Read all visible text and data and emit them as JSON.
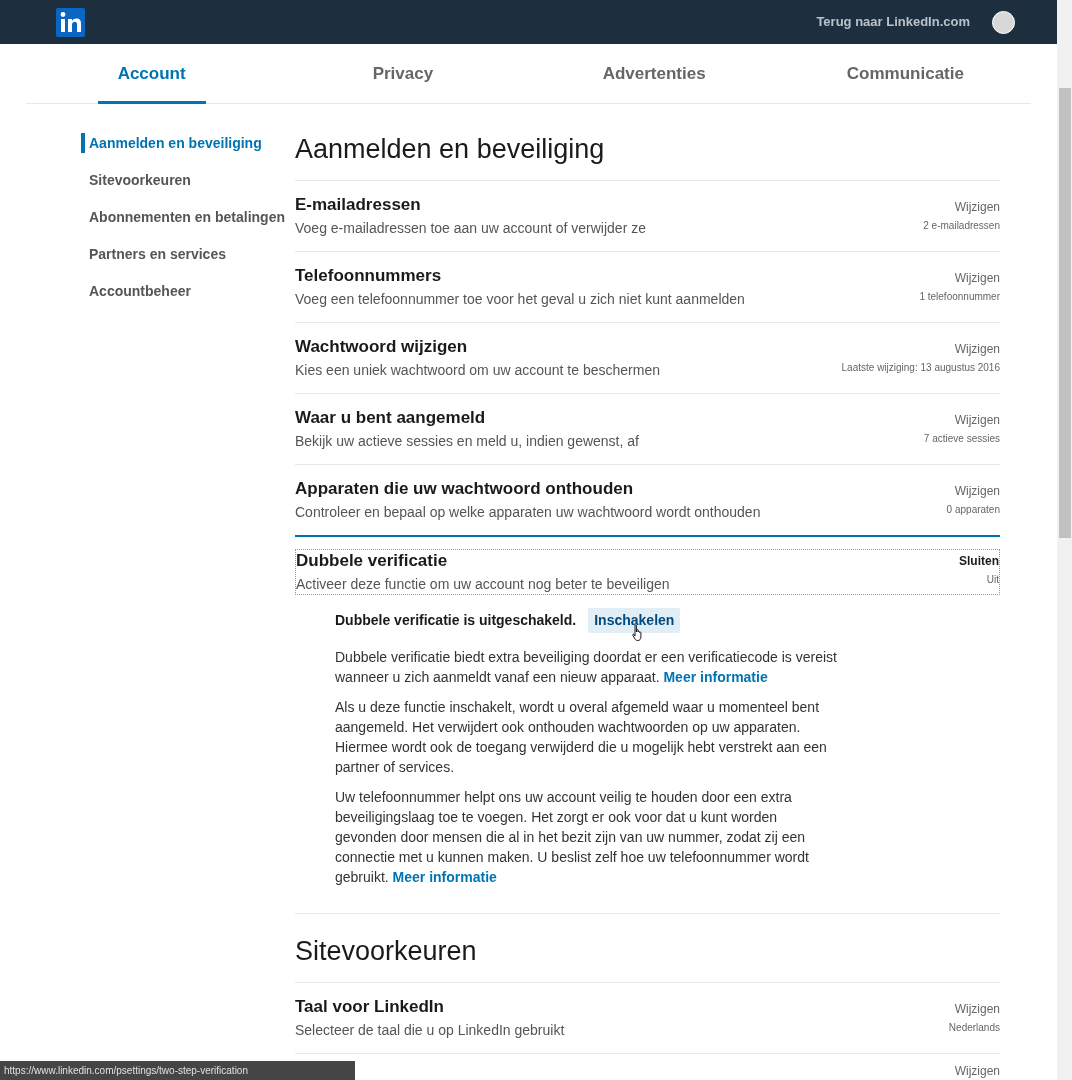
{
  "header": {
    "back_link": "Terug naar LinkedIn.com"
  },
  "tabs": [
    {
      "label": "Account",
      "selected": true
    },
    {
      "label": "Privacy",
      "selected": false
    },
    {
      "label": "Advertenties",
      "selected": false
    },
    {
      "label": "Communicatie",
      "selected": false
    }
  ],
  "sidebar": {
    "items": [
      {
        "label": "Aanmelden en beveiliging",
        "selected": true
      },
      {
        "label": "Sitevoorkeuren",
        "selected": false
      },
      {
        "label": "Abonnementen en betalingen",
        "selected": false
      },
      {
        "label": "Partners en services",
        "selected": false
      },
      {
        "label": "Accountbeheer",
        "selected": false
      }
    ]
  },
  "sections": [
    {
      "title": "Aanmelden en beveiliging",
      "items": [
        {
          "title": "E-mailadressen",
          "description": "Voeg e-mailadressen toe aan uw account of verwijder ze",
          "action": "Wijzigen",
          "summary": "2 e-mailadressen"
        },
        {
          "title": "Telefoonnummers",
          "description": "Voeg een telefoonnummer toe voor het geval u zich niet kunt aanmelden",
          "action": "Wijzigen",
          "summary": "1 telefoonnummer"
        },
        {
          "title": "Wachtwoord wijzigen",
          "description": "Kies een uniek wachtwoord om uw account te beschermen",
          "action": "Wijzigen",
          "summary": "Laatste wijziging: 13 augustus 2016"
        },
        {
          "title": "Waar u bent aangemeld",
          "description": "Bekijk uw actieve sessies en meld u, indien gewenst, af",
          "action": "Wijzigen",
          "summary": "7 actieve sessies"
        },
        {
          "title": "Apparaten die uw wachtwoord onthouden",
          "description": "Controleer en bepaal op welke apparaten uw wachtwoord wordt onthouden",
          "action": "Wijzigen",
          "summary": "0 apparaten"
        },
        {
          "title": "Dubbele verificatie",
          "description": "Activeer deze functie om uw account nog beter te beveiligen",
          "action": "Sluiten",
          "summary": "Uit",
          "expanded": true,
          "details": {
            "status": "Dubbele verificatie is uitgeschakeld.",
            "button": "Inschakelen",
            "paragraphs": [
              {
                "text": "Dubbele verificatie biedt extra beveiliging doordat er een verificatiecode is vereist wanneer u zich aanmeldt vanaf een nieuw apparaat.",
                "link": "Meer informatie"
              },
              {
                "text": "Als u deze functie inschakelt, wordt u overal afgemeld waar u momenteel bent aangemeld. Het verwijdert ook onthouden wachtwoorden op uw apparaten. Hiermee wordt ook de toegang verwijderd die u mogelijk hebt verstrekt aan een partner of services."
              },
              {
                "text": "Uw telefoonnummer helpt ons uw account veilig te houden door een extra beveiligingslaag toe te voegen. Het zorgt er ook voor dat u kunt worden gevonden door mensen die al in het bezit zijn van uw nummer, zodat zij een connectie met u kunnen maken. U beslist zelf hoe uw telefoonnummer wordt gebruikt.",
                "link": "Meer informatie"
              }
            ]
          }
        }
      ]
    },
    {
      "title": "Sitevoorkeuren",
      "items": [
        {
          "title": "Taal voor LinkedIn",
          "description": "Selecteer de taal die u op LinkedIn gebruikt",
          "action": "Wijzigen",
          "summary": "Nederlands"
        },
        {
          "action": "Wijzigen"
        }
      ]
    }
  ],
  "status_bar": {
    "url": "https://www.linkedin.com/psettings/two-step-verification"
  }
}
